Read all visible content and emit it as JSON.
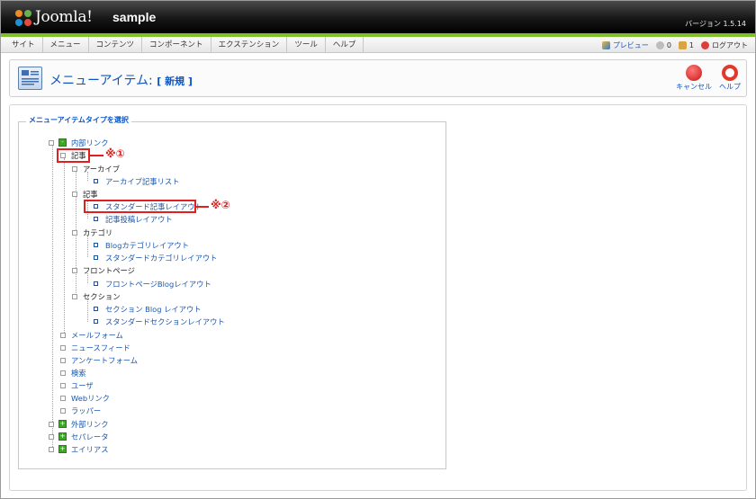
{
  "header": {
    "brand": "Joomla!",
    "site_name": "sample",
    "version": "バージョン 1.5.14"
  },
  "menubar": {
    "items": [
      "サイト",
      "メニュー",
      "コンテンツ",
      "コンポーネント",
      "エクステンション",
      "ツール",
      "ヘルプ"
    ],
    "preview": "プレビュー",
    "messages_count": "0",
    "users_count": "1",
    "logout": "ログアウト"
  },
  "toolbar": {
    "title": "メニューアイテム:",
    "subtitle": "[ 新規 ]",
    "cancel": "キャンセル",
    "help": "ヘルプ"
  },
  "fieldset": {
    "legend": "メニューアイテムタイプを選択"
  },
  "tree": {
    "internal": "内部リンク",
    "article": "記事",
    "archive": "アーカイブ",
    "archive_list": "アーカイブ記事リスト",
    "article_sub": "記事",
    "standard_article_layout": "スタンダード記事レイアウト",
    "article_submit_layout": "記事投稿レイアウト",
    "category": "カテゴリ",
    "blog_category_layout": "Blogカテゴリレイアウト",
    "standard_category_layout": "スタンダードカテゴリレイアウト",
    "frontpage": "フロントページ",
    "frontpage_blog_layout": "フロントページBlogレイアウト",
    "section": "セクション",
    "section_blog_layout": "セクション Blog レイアウト",
    "standard_section_layout": "スタンダードセクションレイアウト",
    "mailform": "メールフォーム",
    "newsfeed": "ニュースフィード",
    "poll": "アンケートフォーム",
    "search": "検索",
    "user": "ユーザ",
    "weblink": "Webリンク",
    "wrapper": "ラッパー",
    "external": "外部リンク",
    "separator": "セパレータ",
    "alias": "エイリアス"
  },
  "annotations": {
    "mark1": "※①",
    "mark2": "※②"
  },
  "colors": {
    "link_blue": "#1a57b0",
    "accent_green": "#7fbf2a",
    "annotation_red": "#e02020"
  }
}
